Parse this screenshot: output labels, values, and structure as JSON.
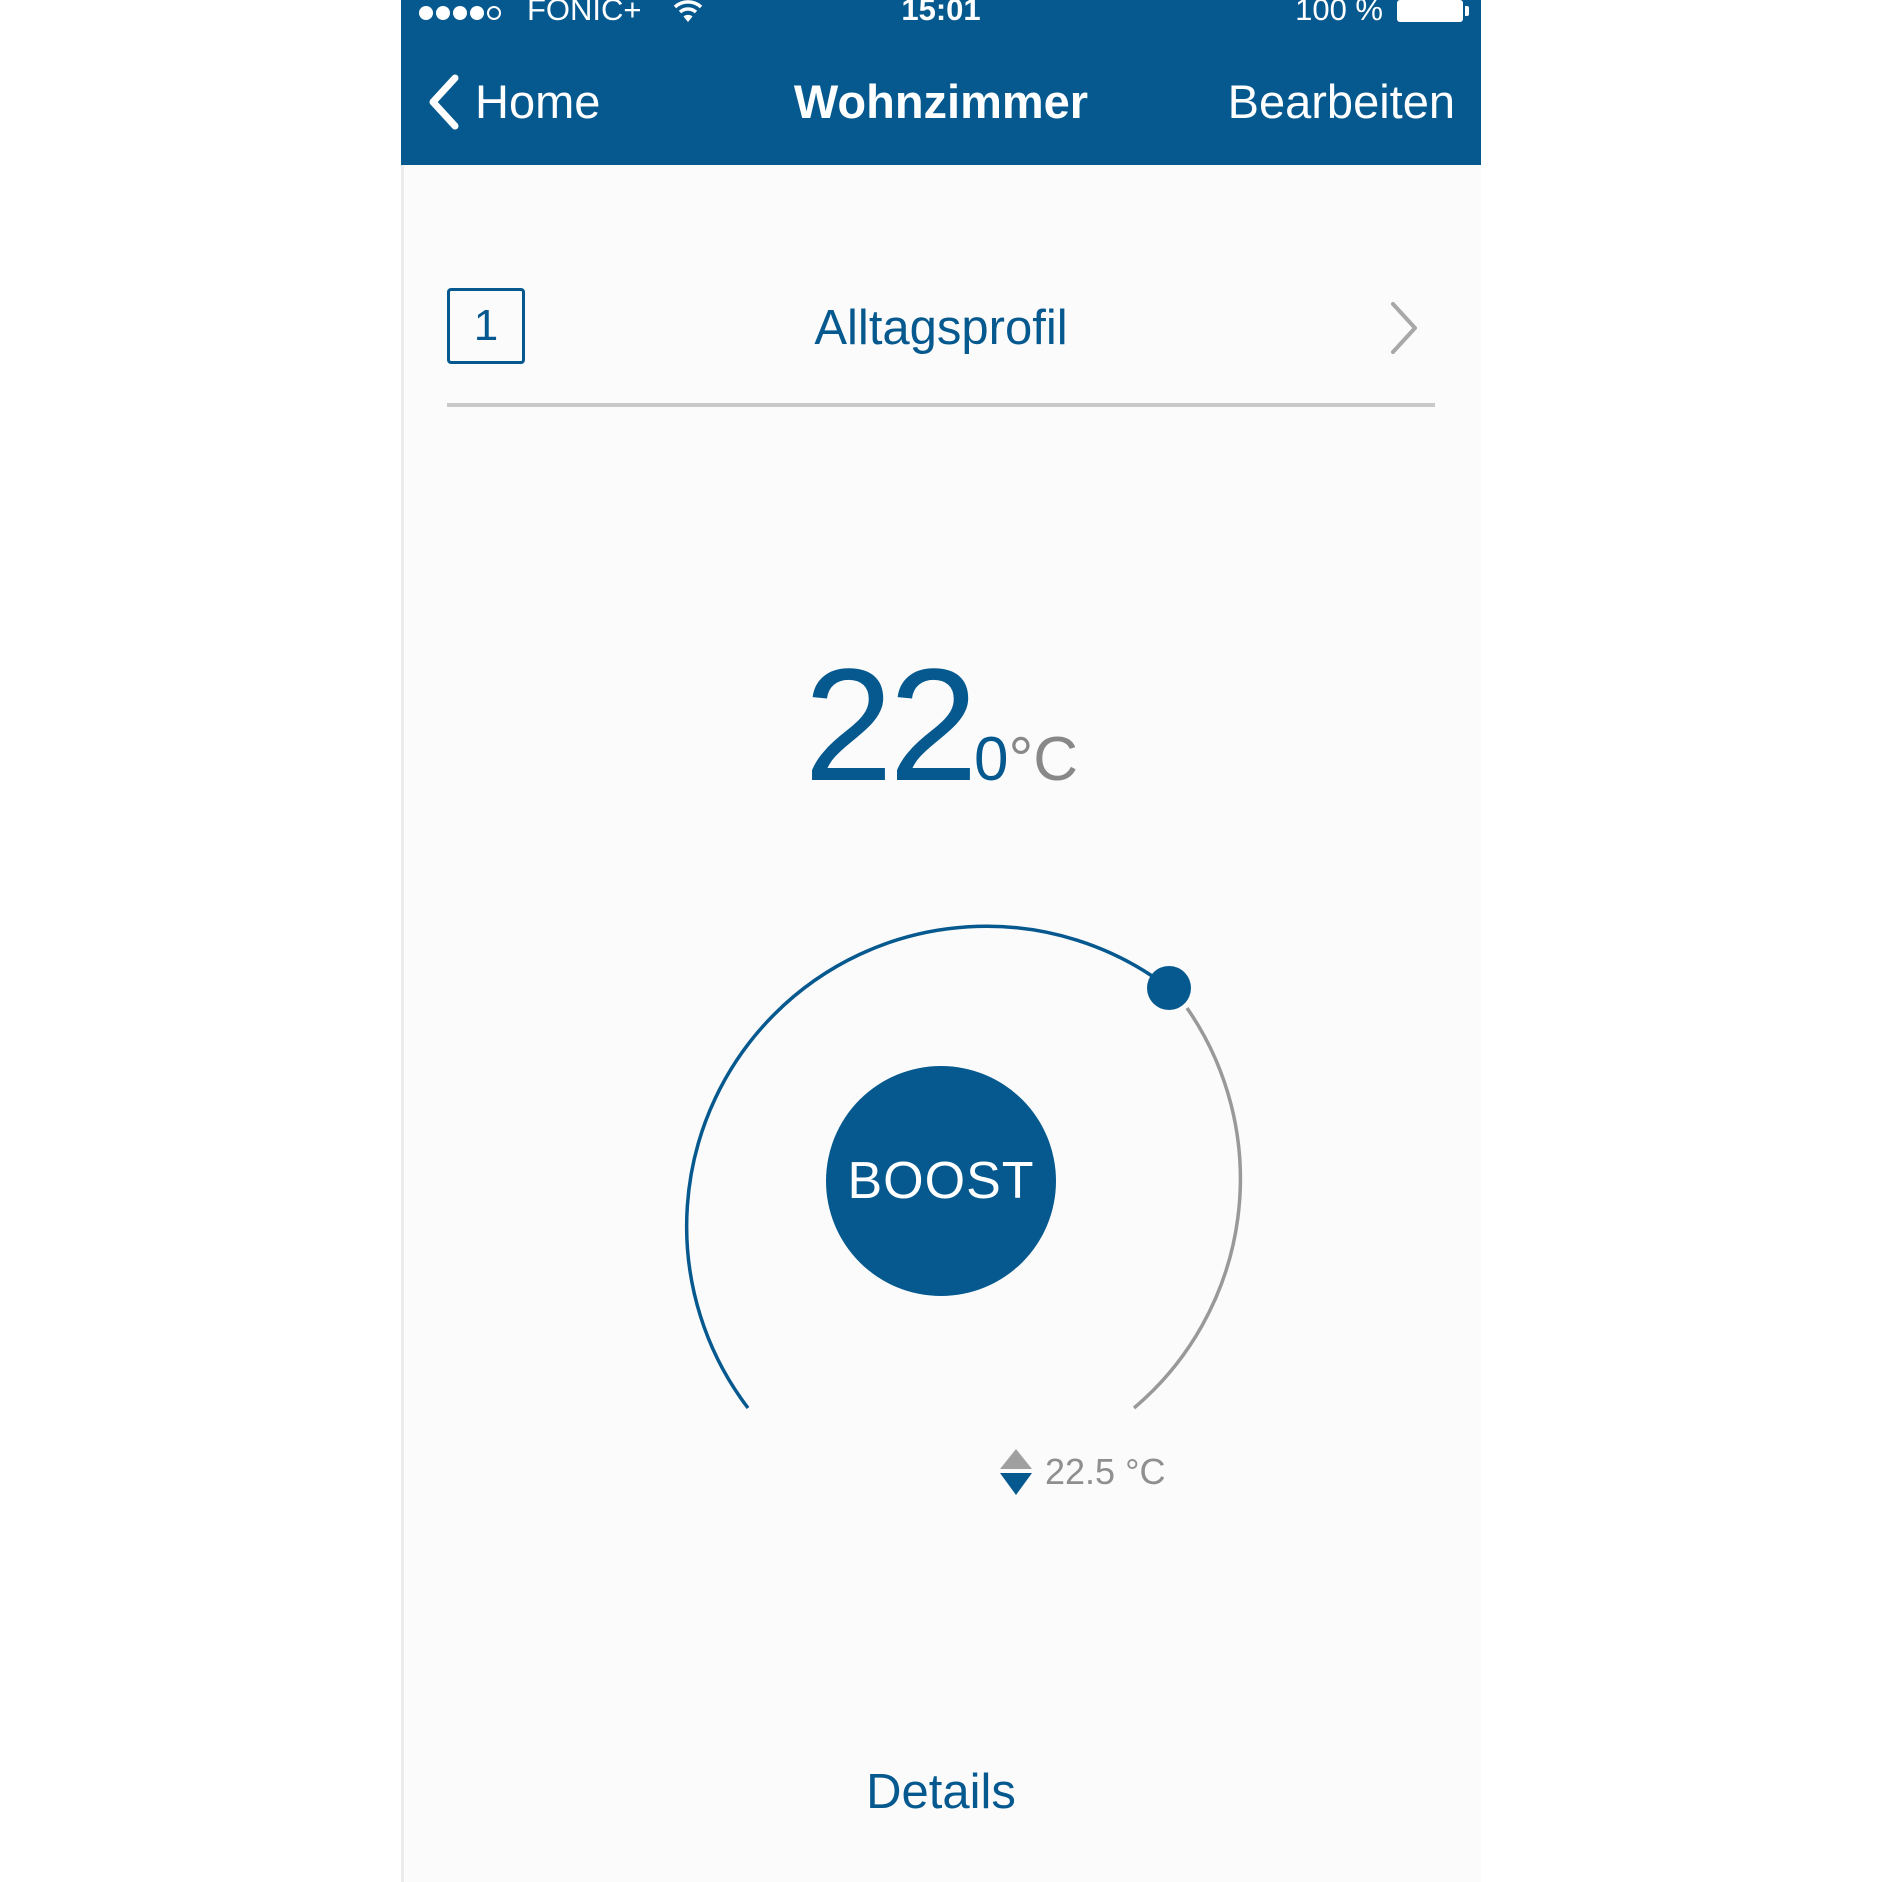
{
  "status_bar": {
    "carrier": "FONIC+",
    "time": "15:01",
    "battery": "100 %",
    "icons": [
      "signal-dots-icon",
      "wifi-icon",
      "battery-icon"
    ]
  },
  "nav": {
    "back_label": "Home",
    "title": "Wohnzimmer",
    "edit_label": "Bearbeiten",
    "icons": [
      "chevron-left-icon"
    ]
  },
  "profile": {
    "number": "1",
    "name": "Alltagsprofil",
    "icon": "chevron-right-icon"
  },
  "temperature": {
    "whole": "22",
    "decimal": "0",
    "unit": "°C"
  },
  "dial": {
    "boost_label": "BOOST",
    "measured_value": "22.5 °C",
    "measured_icon": "up-down-arrows-icon"
  },
  "footer": {
    "details_label": "Details"
  },
  "colors": {
    "primary": "#06598f",
    "header_bg": "#06598f",
    "inactive_arc": "#999999",
    "secondary_text": "#8f8f8f",
    "background": "#fbfbfb"
  }
}
